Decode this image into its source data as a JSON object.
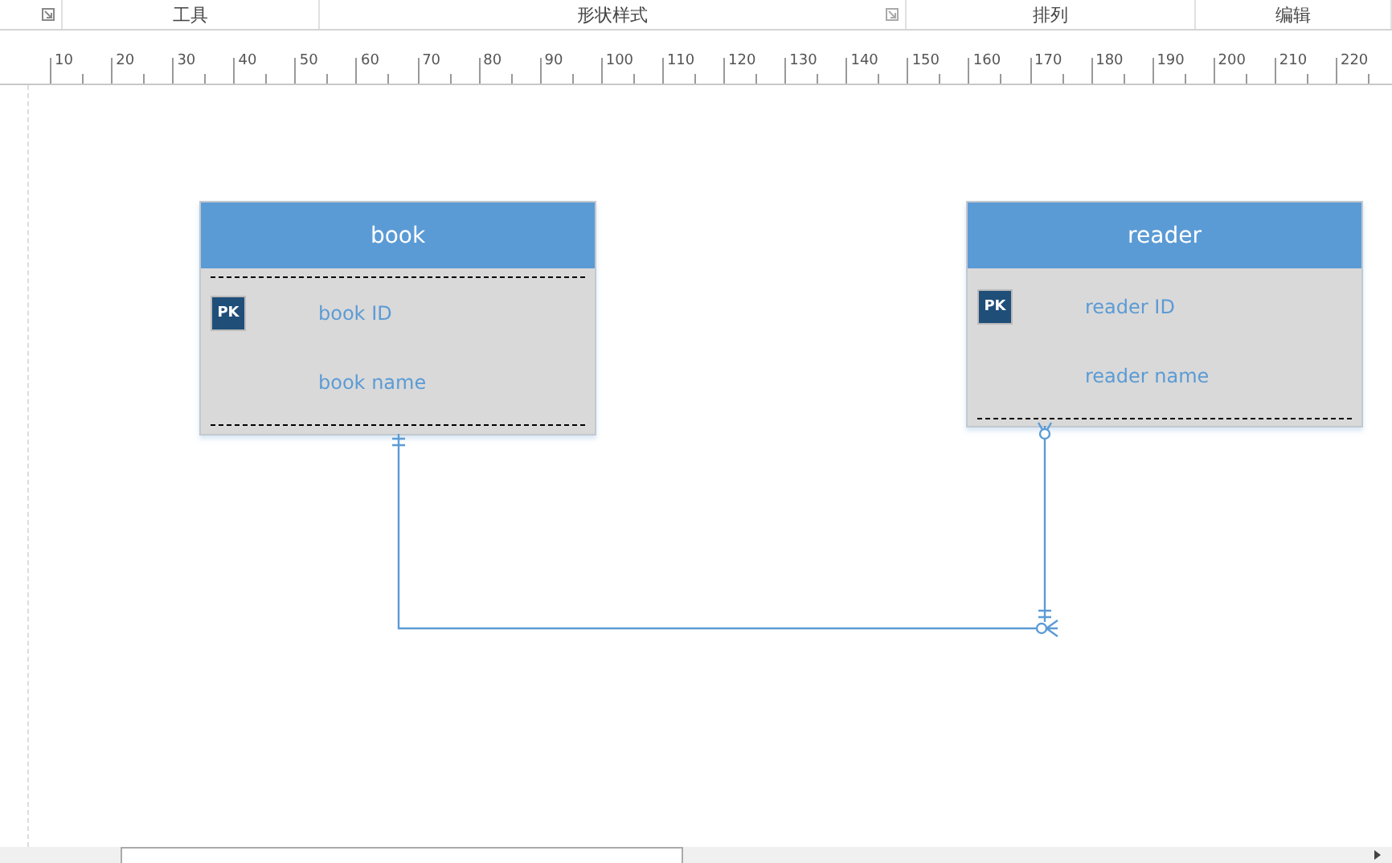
{
  "ribbon_groups": [
    {
      "label": "工具",
      "launcher": false
    },
    {
      "label": "形状样式",
      "launcher": true
    },
    {
      "label": "排列",
      "launcher": false
    },
    {
      "label": "编辑",
      "launcher": false
    }
  ],
  "ruler": {
    "labels": [
      "10",
      "20",
      "30",
      "40",
      "50",
      "60",
      "70",
      "80",
      "90",
      "100",
      "110",
      "120",
      "130",
      "140",
      "150",
      "160",
      "170",
      "180",
      "190",
      "200",
      "210",
      "220"
    ]
  },
  "entities": [
    {
      "title": "book",
      "separator_above": true,
      "fields": [
        {
          "name": "book ID",
          "pk": true,
          "pk_label": "PK"
        },
        {
          "name": "book name",
          "pk": false
        }
      ]
    },
    {
      "title": "reader",
      "separator_above": false,
      "fields": [
        {
          "name": "reader ID",
          "pk": true,
          "pk_label": "PK"
        },
        {
          "name": "reader name",
          "pk": false
        }
      ]
    }
  ]
}
